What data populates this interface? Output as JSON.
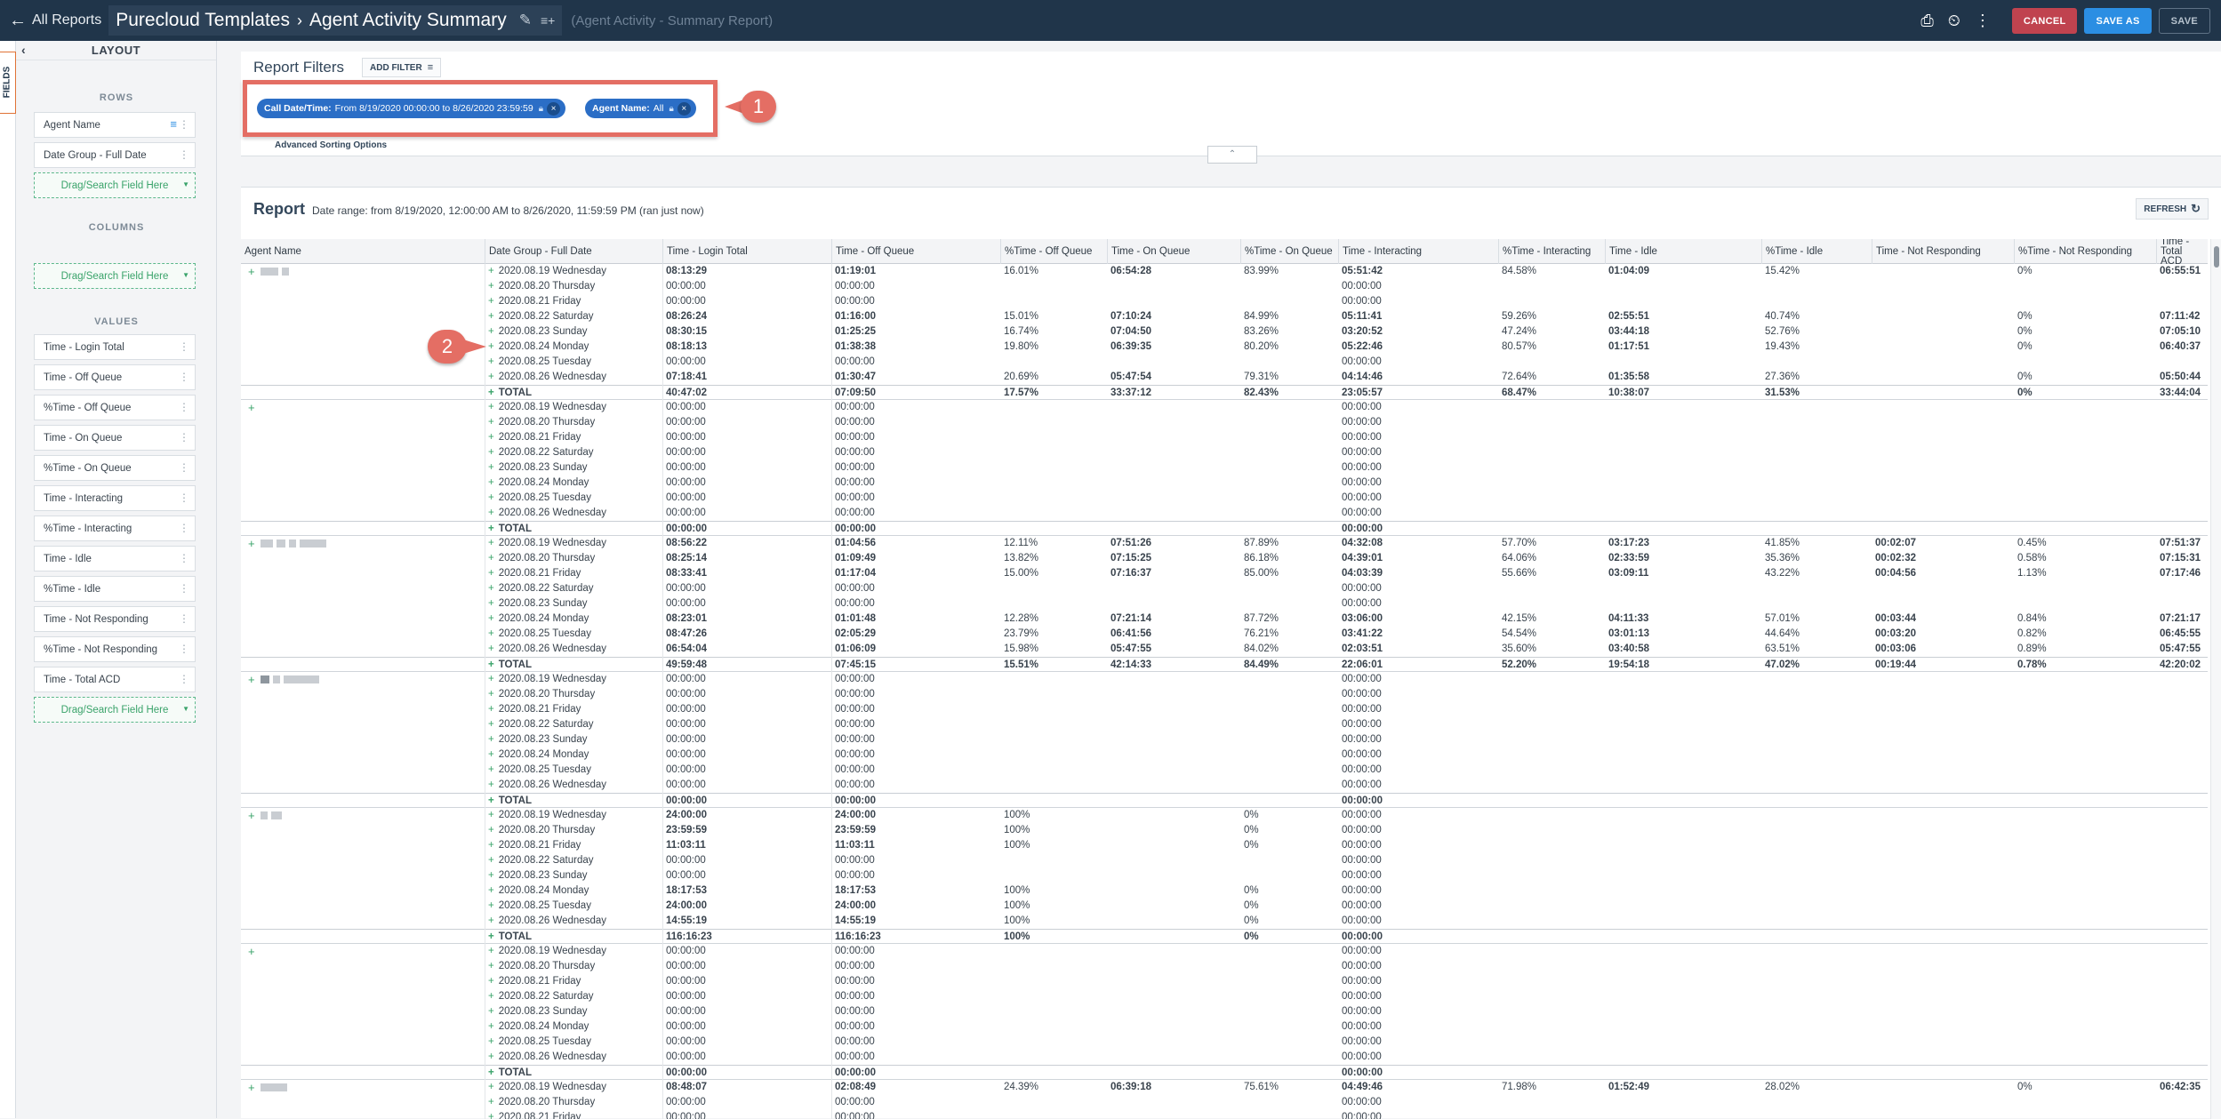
{
  "topbar": {
    "back_label": "All Reports",
    "crumb_1": "Purecloud Templates",
    "crumb_2": "Agent Activity Summary",
    "subtitle": "(Agent Activity - Summary Report)",
    "cancel_label": "CANCEL",
    "save_as_label": "SAVE AS",
    "save_label": "SAVE"
  },
  "sidebar": {
    "fields_tab": "FIELDS",
    "layout_title": "LAYOUT",
    "rows_label": "ROWS",
    "rows": [
      "Agent Name",
      "Date Group - Full Date"
    ],
    "columns_label": "COLUMNS",
    "values_label": "VALUES",
    "values": [
      "Time - Login Total",
      "Time - Off Queue",
      "%Time - Off Queue",
      "Time - On Queue",
      "%Time - On Queue",
      "Time - Interacting",
      "%Time - Interacting",
      "Time - Idle",
      "%Time - Idle",
      "Time - Not Responding",
      "%Time - Not Responding",
      "Time - Total ACD"
    ],
    "drop_label": "Drag/Search Field Here"
  },
  "filters": {
    "title": "Report Filters",
    "add_filter": "ADD FILTER",
    "chip_1_key": "Call Date/Time:",
    "chip_1_val": "From 8/19/2020 00:00:00 to 8/26/2020 23:59:59",
    "chip_2_key": "Agent Name:",
    "chip_2_val": "All",
    "advanced": "Advanced Sorting Options",
    "callout_1": "1"
  },
  "report": {
    "title": "Report",
    "range": "Date range: from 8/19/2020, 12:00:00 AM to 8/26/2020, 11:59:59 PM (ran just now)",
    "refresh": "REFRESH",
    "callout_2": "2",
    "headers": [
      "Agent Name",
      "Date Group - Full Date",
      "Time - Login Total",
      "Time - Off Queue",
      "%Time - Off Queue",
      "Time - On Queue",
      "%Time - On Queue",
      "Time - Interacting",
      "%Time - Interacting",
      "Time - Idle",
      "%Time - Idle",
      "Time - Not Responding",
      "%Time - Not Responding",
      "Time - Total ACD"
    ],
    "dates": [
      "2020.08.19 Wednesday",
      "2020.08.20 Thursday",
      "2020.08.21 Friday",
      "2020.08.22 Saturday",
      "2020.08.23 Sunday",
      "2020.08.24 Monday",
      "2020.08.25 Tuesday",
      "2020.08.26 Wednesday",
      "TOTAL"
    ],
    "groups": [
      {
        "rows": [
          [
            "08:13:29",
            "01:19:01",
            "16.01%",
            "06:54:28",
            "83.99%",
            "05:51:42",
            "84.58%",
            "01:04:09",
            "15.42%",
            "",
            "0%",
            "06:55:51"
          ],
          [
            "00:00:00",
            "00:00:00",
            "",
            "",
            "",
            "00:00:00",
            "",
            "",
            "",
            "",
            "",
            ""
          ],
          [
            "00:00:00",
            "00:00:00",
            "",
            "",
            "",
            "00:00:00",
            "",
            "",
            "",
            "",
            "",
            ""
          ],
          [
            "08:26:24",
            "01:16:00",
            "15.01%",
            "07:10:24",
            "84.99%",
            "05:11:41",
            "59.26%",
            "02:55:51",
            "40.74%",
            "",
            "0%",
            "07:11:42"
          ],
          [
            "08:30:15",
            "01:25:25",
            "16.74%",
            "07:04:50",
            "83.26%",
            "03:20:52",
            "47.24%",
            "03:44:18",
            "52.76%",
            "",
            "0%",
            "07:05:10"
          ],
          [
            "08:18:13",
            "01:38:38",
            "19.80%",
            "06:39:35",
            "80.20%",
            "05:22:46",
            "80.57%",
            "01:17:51",
            "19.43%",
            "",
            "0%",
            "06:40:37"
          ],
          [
            "00:00:00",
            "00:00:00",
            "",
            "",
            "",
            "00:00:00",
            "",
            "",
            "",
            "",
            "",
            ""
          ],
          [
            "07:18:41",
            "01:30:47",
            "20.69%",
            "05:47:54",
            "79.31%",
            "04:14:46",
            "72.64%",
            "01:35:58",
            "27.36%",
            "",
            "0%",
            "05:50:44"
          ],
          [
            "40:47:02",
            "07:09:50",
            "17.57%",
            "33:37:12",
            "82.43%",
            "23:05:57",
            "68.47%",
            "10:38:07",
            "31.53%",
            "",
            "0%",
            "33:44:04"
          ]
        ]
      },
      {
        "rows": [
          [
            "00:00:00",
            "00:00:00",
            "",
            "",
            "",
            "00:00:00",
            "",
            "",
            "",
            "",
            "",
            ""
          ],
          [
            "00:00:00",
            "00:00:00",
            "",
            "",
            "",
            "00:00:00",
            "",
            "",
            "",
            "",
            "",
            ""
          ],
          [
            "00:00:00",
            "00:00:00",
            "",
            "",
            "",
            "00:00:00",
            "",
            "",
            "",
            "",
            "",
            ""
          ],
          [
            "00:00:00",
            "00:00:00",
            "",
            "",
            "",
            "00:00:00",
            "",
            "",
            "",
            "",
            "",
            ""
          ],
          [
            "00:00:00",
            "00:00:00",
            "",
            "",
            "",
            "00:00:00",
            "",
            "",
            "",
            "",
            "",
            ""
          ],
          [
            "00:00:00",
            "00:00:00",
            "",
            "",
            "",
            "00:00:00",
            "",
            "",
            "",
            "",
            "",
            ""
          ],
          [
            "00:00:00",
            "00:00:00",
            "",
            "",
            "",
            "00:00:00",
            "",
            "",
            "",
            "",
            "",
            ""
          ],
          [
            "00:00:00",
            "00:00:00",
            "",
            "",
            "",
            "00:00:00",
            "",
            "",
            "",
            "",
            "",
            ""
          ],
          [
            "00:00:00",
            "00:00:00",
            "",
            "",
            "",
            "00:00:00",
            "",
            "",
            "",
            "",
            "",
            ""
          ]
        ]
      },
      {
        "rows": [
          [
            "08:56:22",
            "01:04:56",
            "12.11%",
            "07:51:26",
            "87.89%",
            "04:32:08",
            "57.70%",
            "03:17:23",
            "41.85%",
            "00:02:07",
            "0.45%",
            "07:51:37"
          ],
          [
            "08:25:14",
            "01:09:49",
            "13.82%",
            "07:15:25",
            "86.18%",
            "04:39:01",
            "64.06%",
            "02:33:59",
            "35.36%",
            "00:02:32",
            "0.58%",
            "07:15:31"
          ],
          [
            "08:33:41",
            "01:17:04",
            "15.00%",
            "07:16:37",
            "85.00%",
            "04:03:39",
            "55.66%",
            "03:09:11",
            "43.22%",
            "00:04:56",
            "1.13%",
            "07:17:46"
          ],
          [
            "00:00:00",
            "00:00:00",
            "",
            "",
            "",
            "00:00:00",
            "",
            "",
            "",
            "",
            "",
            ""
          ],
          [
            "00:00:00",
            "00:00:00",
            "",
            "",
            "",
            "00:00:00",
            "",
            "",
            "",
            "",
            "",
            ""
          ],
          [
            "08:23:01",
            "01:01:48",
            "12.28%",
            "07:21:14",
            "87.72%",
            "03:06:00",
            "42.15%",
            "04:11:33",
            "57.01%",
            "00:03:44",
            "0.84%",
            "07:21:17"
          ],
          [
            "08:47:26",
            "02:05:29",
            "23.79%",
            "06:41:56",
            "76.21%",
            "03:41:22",
            "54.54%",
            "03:01:13",
            "44.64%",
            "00:03:20",
            "0.82%",
            "06:45:55"
          ],
          [
            "06:54:04",
            "01:06:09",
            "15.98%",
            "05:47:55",
            "84.02%",
            "02:03:51",
            "35.60%",
            "03:40:58",
            "63.51%",
            "00:03:06",
            "0.89%",
            "05:47:55"
          ],
          [
            "49:59:48",
            "07:45:15",
            "15.51%",
            "42:14:33",
            "84.49%",
            "22:06:01",
            "52.20%",
            "19:54:18",
            "47.02%",
            "00:19:44",
            "0.78%",
            "42:20:02"
          ]
        ]
      },
      {
        "rows": [
          [
            "00:00:00",
            "00:00:00",
            "",
            "",
            "",
            "00:00:00",
            "",
            "",
            "",
            "",
            "",
            ""
          ],
          [
            "00:00:00",
            "00:00:00",
            "",
            "",
            "",
            "00:00:00",
            "",
            "",
            "",
            "",
            "",
            ""
          ],
          [
            "00:00:00",
            "00:00:00",
            "",
            "",
            "",
            "00:00:00",
            "",
            "",
            "",
            "",
            "",
            ""
          ],
          [
            "00:00:00",
            "00:00:00",
            "",
            "",
            "",
            "00:00:00",
            "",
            "",
            "",
            "",
            "",
            ""
          ],
          [
            "00:00:00",
            "00:00:00",
            "",
            "",
            "",
            "00:00:00",
            "",
            "",
            "",
            "",
            "",
            ""
          ],
          [
            "00:00:00",
            "00:00:00",
            "",
            "",
            "",
            "00:00:00",
            "",
            "",
            "",
            "",
            "",
            ""
          ],
          [
            "00:00:00",
            "00:00:00",
            "",
            "",
            "",
            "00:00:00",
            "",
            "",
            "",
            "",
            "",
            ""
          ],
          [
            "00:00:00",
            "00:00:00",
            "",
            "",
            "",
            "00:00:00",
            "",
            "",
            "",
            "",
            "",
            ""
          ],
          [
            "00:00:00",
            "00:00:00",
            "",
            "",
            "",
            "00:00:00",
            "",
            "",
            "",
            "",
            "",
            ""
          ]
        ]
      },
      {
        "rows": [
          [
            "24:00:00",
            "24:00:00",
            "100%",
            "",
            "0%",
            "00:00:00",
            "",
            "",
            "",
            "",
            "",
            ""
          ],
          [
            "23:59:59",
            "23:59:59",
            "100%",
            "",
            "0%",
            "00:00:00",
            "",
            "",
            "",
            "",
            "",
            ""
          ],
          [
            "11:03:11",
            "11:03:11",
            "100%",
            "",
            "0%",
            "00:00:00",
            "",
            "",
            "",
            "",
            "",
            ""
          ],
          [
            "00:00:00",
            "00:00:00",
            "",
            "",
            "",
            "00:00:00",
            "",
            "",
            "",
            "",
            "",
            ""
          ],
          [
            "00:00:00",
            "00:00:00",
            "",
            "",
            "",
            "00:00:00",
            "",
            "",
            "",
            "",
            "",
            ""
          ],
          [
            "18:17:53",
            "18:17:53",
            "100%",
            "",
            "0%",
            "00:00:00",
            "",
            "",
            "",
            "",
            "",
            ""
          ],
          [
            "24:00:00",
            "24:00:00",
            "100%",
            "",
            "0%",
            "00:00:00",
            "",
            "",
            "",
            "",
            "",
            ""
          ],
          [
            "14:55:19",
            "14:55:19",
            "100%",
            "",
            "0%",
            "00:00:00",
            "",
            "",
            "",
            "",
            "",
            ""
          ],
          [
            "116:16:23",
            "116:16:23",
            "100%",
            "",
            "0%",
            "00:00:00",
            "",
            "",
            "",
            "",
            "",
            ""
          ]
        ]
      },
      {
        "rows": [
          [
            "00:00:00",
            "00:00:00",
            "",
            "",
            "",
            "00:00:00",
            "",
            "",
            "",
            "",
            "",
            ""
          ],
          [
            "00:00:00",
            "00:00:00",
            "",
            "",
            "",
            "00:00:00",
            "",
            "",
            "",
            "",
            "",
            ""
          ],
          [
            "00:00:00",
            "00:00:00",
            "",
            "",
            "",
            "00:00:00",
            "",
            "",
            "",
            "",
            "",
            ""
          ],
          [
            "00:00:00",
            "00:00:00",
            "",
            "",
            "",
            "00:00:00",
            "",
            "",
            "",
            "",
            "",
            ""
          ],
          [
            "00:00:00",
            "00:00:00",
            "",
            "",
            "",
            "00:00:00",
            "",
            "",
            "",
            "",
            "",
            ""
          ],
          [
            "00:00:00",
            "00:00:00",
            "",
            "",
            "",
            "00:00:00",
            "",
            "",
            "",
            "",
            "",
            ""
          ],
          [
            "00:00:00",
            "00:00:00",
            "",
            "",
            "",
            "00:00:00",
            "",
            "",
            "",
            "",
            "",
            ""
          ],
          [
            "00:00:00",
            "00:00:00",
            "",
            "",
            "",
            "00:00:00",
            "",
            "",
            "",
            "",
            "",
            ""
          ],
          [
            "00:00:00",
            "00:00:00",
            "",
            "",
            "",
            "00:00:00",
            "",
            "",
            "",
            "",
            "",
            ""
          ]
        ]
      },
      {
        "rows": [
          [
            "08:48:07",
            "02:08:49",
            "24.39%",
            "06:39:18",
            "75.61%",
            "04:49:46",
            "71.98%",
            "01:52:49",
            "28.02%",
            "",
            "0%",
            "06:42:35"
          ],
          [
            "00:00:00",
            "00:00:00",
            "",
            "",
            "",
            "00:00:00",
            "",
            "",
            "",
            "",
            "",
            ""
          ],
          [
            "00:00:00",
            "00:00:00",
            "",
            "",
            "",
            "00:00:00",
            "",
            "",
            "",
            "",
            "",
            ""
          ]
        ]
      }
    ]
  }
}
